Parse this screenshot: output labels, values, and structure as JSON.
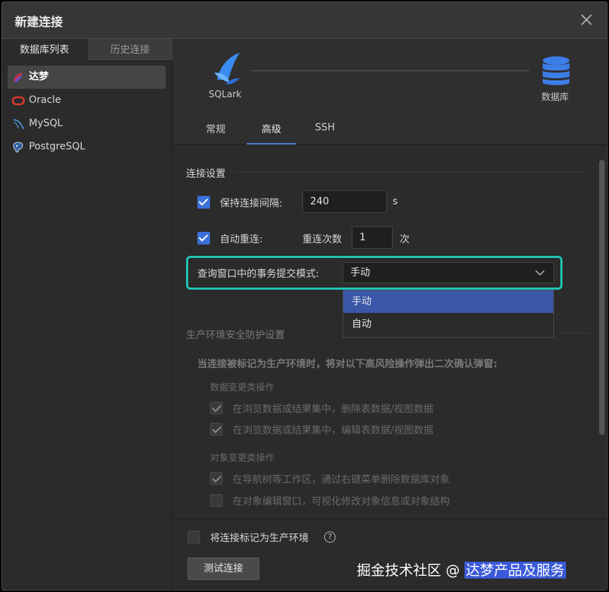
{
  "window": {
    "title": "新建连接"
  },
  "left_tabs": {
    "active": "数据库列表",
    "inactive": "历史连接"
  },
  "db_list": [
    {
      "name": "达梦",
      "icon": "dameng-icon",
      "selected": true
    },
    {
      "name": "Oracle",
      "icon": "oracle-icon",
      "selected": false
    },
    {
      "name": "MySQL",
      "icon": "mysql-icon",
      "selected": false
    },
    {
      "name": "PostgreSQL",
      "icon": "postgresql-icon",
      "selected": false
    }
  ],
  "header": {
    "client_label": "SQLark",
    "target_label": "数据库"
  },
  "tabs": [
    "常规",
    "高级",
    "SSH"
  ],
  "active_tab": "高级",
  "connection_settings": {
    "title": "连接设置",
    "keepalive_label": "保持连接间隔:",
    "keepalive_value": "240",
    "keepalive_unit": "s",
    "keepalive_checked": true,
    "auto_reconnect_label": "自动重连:",
    "auto_reconnect_checked": true,
    "retry_label": "重连次数",
    "retry_value": "1",
    "retry_unit": "次",
    "commit_mode_label": "查询窗口中的事务提交模式:",
    "commit_mode_value": "手动",
    "commit_mode_options": [
      "手动",
      "自动"
    ]
  },
  "production_settings": {
    "title": "生产环境安全防护设置",
    "description": "当连接被标记为生产环境时，将对以下高风险操作弹出二次确认弹窗:",
    "groups": [
      {
        "title": "数据变更类操作",
        "items": [
          {
            "label": "在浏览数据或结果集中，删除表数据/视图数据",
            "checked": true
          },
          {
            "label": "在浏览数据或结果集中，编辑表数据/视图数据",
            "checked": true
          }
        ]
      },
      {
        "title": "对象变更类操作",
        "items": [
          {
            "label": "在导航树等工作区，通过右键菜单删除数据库对象",
            "checked": true
          },
          {
            "label": "在对象编辑窗口，可视化修改对象信息或对象结构",
            "checked": false
          }
        ]
      }
    ]
  },
  "footer": {
    "mark_production_label": "将连接标记为生产环境",
    "mark_production_checked": false,
    "help_glyph": "?",
    "test_button": "测试连接"
  },
  "watermark": {
    "prefix": "掘金技术社区 @ ",
    "highlight": "达梦产品及服务"
  },
  "colors": {
    "accent": "#3a6fd8",
    "highlight_border": "#1ec6b6",
    "dropdown_selected": "#3a57a8"
  }
}
